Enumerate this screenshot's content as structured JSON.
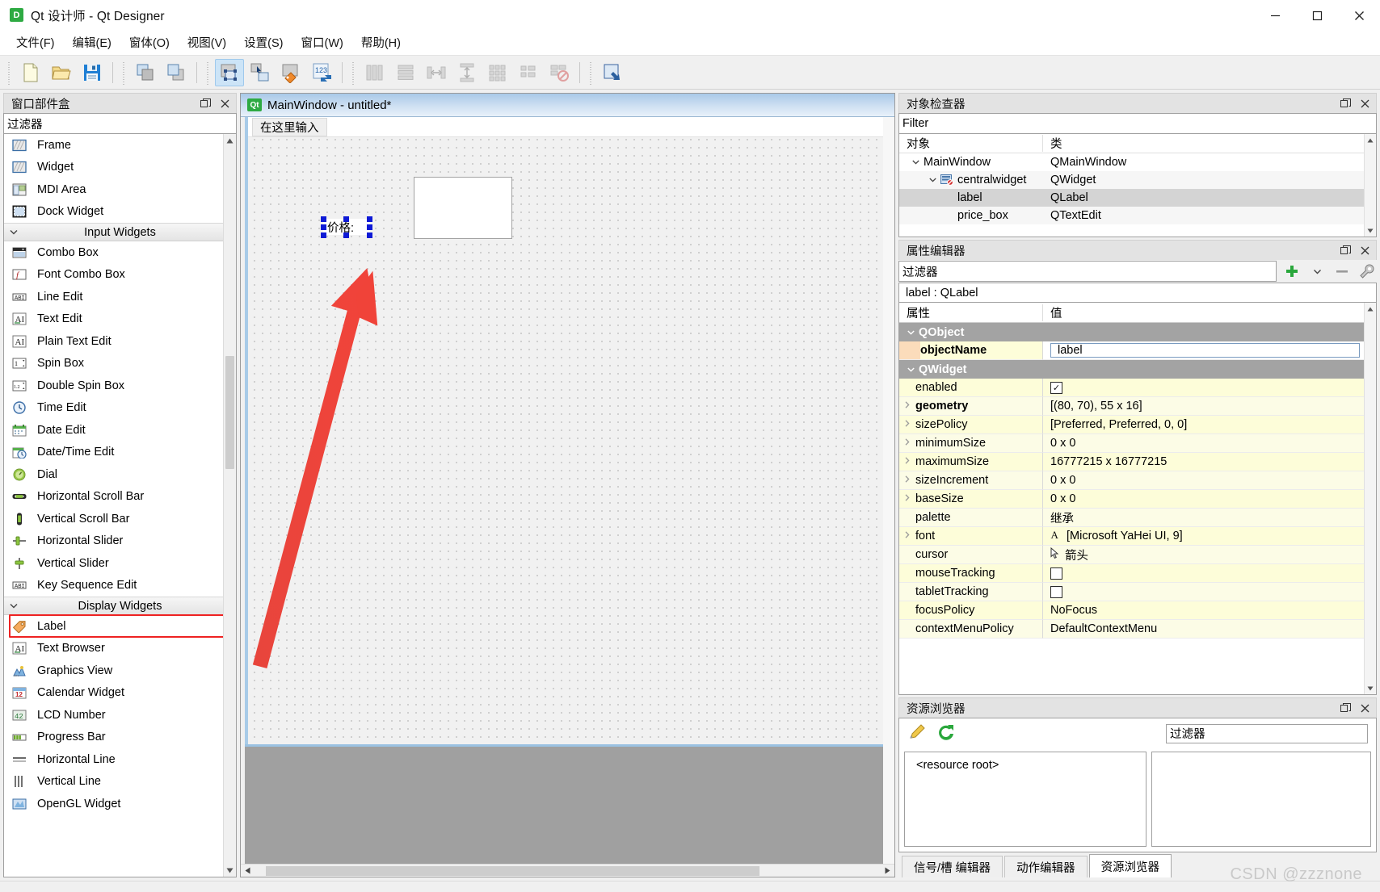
{
  "window": {
    "title": "Qt 设计师 - Qt Designer",
    "logo_text": "D",
    "minimize": "–",
    "maximize": "☐",
    "close": "✕"
  },
  "menubar": {
    "items": [
      {
        "label": "文件(F)"
      },
      {
        "label": "编辑(E)"
      },
      {
        "label": "窗体(O)"
      },
      {
        "label": "视图(V)"
      },
      {
        "label": "设置(S)"
      },
      {
        "label": "窗口(W)"
      },
      {
        "label": "帮助(H)"
      }
    ]
  },
  "toolbar": {
    "groups": [
      [
        "new-file-icon",
        "open-folder-icon",
        "save-disk-icon"
      ],
      [
        "copy-windows-icon",
        "paste-window-icon"
      ],
      [
        "edit-widgets-icon",
        "edit-signals-slots-icon",
        "edit-buddies-icon",
        "edit-tab-order-icon"
      ],
      [
        "layout-horizontally-icon",
        "layout-vertically-icon",
        "layout-splitter-h-icon",
        "layout-splitter-v-icon",
        "layout-grid-icon",
        "layout-form-icon",
        "break-layout-icon"
      ],
      [
        "adjust-size-icon"
      ]
    ],
    "active_index": "edit-widgets-icon"
  },
  "widget_box": {
    "title": "窗口部件盒",
    "filter_value": "过滤器",
    "float_icon": "undock-icon",
    "items": [
      {
        "label": "Frame",
        "icon": "frame-icon",
        "type": "item"
      },
      {
        "label": "Widget",
        "icon": "widget-icon",
        "type": "item"
      },
      {
        "label": "MDI Area",
        "icon": "mdi-area-icon",
        "type": "item"
      },
      {
        "label": "Dock Widget",
        "icon": "dock-widget-icon",
        "type": "item"
      },
      {
        "label": "Input Widgets",
        "type": "category"
      },
      {
        "label": "Combo Box",
        "icon": "combo-box-icon",
        "type": "item"
      },
      {
        "label": "Font Combo Box",
        "icon": "font-combo-box-icon",
        "type": "item"
      },
      {
        "label": "Line Edit",
        "icon": "line-edit-icon",
        "type": "item"
      },
      {
        "label": "Text Edit",
        "icon": "text-edit-icon",
        "type": "item"
      },
      {
        "label": "Plain Text Edit",
        "icon": "plain-text-edit-icon",
        "type": "item"
      },
      {
        "label": "Spin Box",
        "icon": "spin-box-icon",
        "type": "item"
      },
      {
        "label": "Double Spin Box",
        "icon": "double-spin-box-icon",
        "type": "item"
      },
      {
        "label": "Time Edit",
        "icon": "time-edit-icon",
        "type": "item"
      },
      {
        "label": "Date Edit",
        "icon": "date-edit-icon",
        "type": "item"
      },
      {
        "label": "Date/Time Edit",
        "icon": "date-time-edit-icon",
        "type": "item"
      },
      {
        "label": "Dial",
        "icon": "dial-icon",
        "type": "item"
      },
      {
        "label": "Horizontal Scroll Bar",
        "icon": "h-scrollbar-icon",
        "type": "item"
      },
      {
        "label": "Vertical Scroll Bar",
        "icon": "v-scrollbar-icon",
        "type": "item"
      },
      {
        "label": "Horizontal Slider",
        "icon": "h-slider-icon",
        "type": "item"
      },
      {
        "label": "Vertical Slider",
        "icon": "v-slider-icon",
        "type": "item"
      },
      {
        "label": "Key Sequence Edit",
        "icon": "key-sequence-edit-icon",
        "type": "item"
      },
      {
        "label": "Display Widgets",
        "type": "category"
      },
      {
        "label": "Label",
        "icon": "label-icon",
        "type": "item",
        "highlighted": true
      },
      {
        "label": "Text Browser",
        "icon": "text-browser-icon",
        "type": "item"
      },
      {
        "label": "Graphics View",
        "icon": "graphics-view-icon",
        "type": "item"
      },
      {
        "label": "Calendar Widget",
        "icon": "calendar-widget-icon",
        "type": "item"
      },
      {
        "label": "LCD Number",
        "icon": "lcd-number-icon",
        "type": "item"
      },
      {
        "label": "Progress Bar",
        "icon": "progress-bar-icon",
        "type": "item"
      },
      {
        "label": "Horizontal Line",
        "icon": "h-line-icon",
        "type": "item"
      },
      {
        "label": "Vertical Line",
        "icon": "v-line-icon",
        "type": "item"
      },
      {
        "label": "OpenGL Widget",
        "icon": "opengl-widget-icon",
        "type": "item"
      }
    ]
  },
  "form_editor": {
    "mdi_title": "MainWindow - untitled*",
    "qt_badge": "Qt",
    "menu_hint": "在这里输入",
    "label_text": "价格:",
    "annotation": "red-arrow-annotation"
  },
  "object_inspector": {
    "title": "对象检查器",
    "filter_placeholder": "Filter",
    "columns": [
      "对象",
      "类"
    ],
    "rows": [
      {
        "name": "MainWindow",
        "cls": "QMainWindow",
        "depth": 0,
        "expanded": true,
        "selected": false
      },
      {
        "name": "centralwidget",
        "cls": "QWidget",
        "depth": 1,
        "expanded": true,
        "selected": false,
        "icon": "central-widget-icon"
      },
      {
        "name": "label",
        "cls": "QLabel",
        "depth": 2,
        "selected": true
      },
      {
        "name": "price_box",
        "cls": "QTextEdit",
        "depth": 2,
        "selected": false
      }
    ]
  },
  "property_editor": {
    "title": "属性编辑器",
    "filter_value": "过滤器",
    "add_icon": "plus-green-icon",
    "remove_icon": "minus-icon",
    "config_icon": "wrench-icon",
    "target": "label : QLabel",
    "columns": [
      "属性",
      "值"
    ],
    "rows": [
      {
        "kind": "group",
        "name": "QObject"
      },
      {
        "kind": "prop",
        "name": "objectName",
        "value": "label",
        "bold": true,
        "editor": "text",
        "swatch": true
      },
      {
        "kind": "group",
        "name": "QWidget"
      },
      {
        "kind": "prop",
        "name": "enabled",
        "value": "",
        "editor": "checkbox-checked"
      },
      {
        "kind": "prop",
        "name": "geometry",
        "value": "[(80, 70), 55 x 16]",
        "bold": true,
        "expandable": true
      },
      {
        "kind": "prop",
        "name": "sizePolicy",
        "value": "[Preferred, Preferred, 0, 0]",
        "expandable": true
      },
      {
        "kind": "prop",
        "name": "minimumSize",
        "value": "0 x 0",
        "expandable": true
      },
      {
        "kind": "prop",
        "name": "maximumSize",
        "value": "16777215 x 16777215",
        "expandable": true
      },
      {
        "kind": "prop",
        "name": "sizeIncrement",
        "value": "0 x 0",
        "expandable": true
      },
      {
        "kind": "prop",
        "name": "baseSize",
        "value": "0 x 0",
        "expandable": true
      },
      {
        "kind": "prop",
        "name": "palette",
        "value": "继承"
      },
      {
        "kind": "prop",
        "name": "font",
        "value": "[Microsoft YaHei UI, 9]",
        "expandable": true,
        "icon": "font-A-icon"
      },
      {
        "kind": "prop",
        "name": "cursor",
        "value": "箭头",
        "icon": "cursor-arrow-icon"
      },
      {
        "kind": "prop",
        "name": "mouseTracking",
        "value": "",
        "editor": "checkbox"
      },
      {
        "kind": "prop",
        "name": "tabletTracking",
        "value": "",
        "editor": "checkbox"
      },
      {
        "kind": "prop",
        "name": "focusPolicy",
        "value": "NoFocus"
      },
      {
        "kind": "prop",
        "name": "contextMenuPolicy",
        "value": "DefaultContextMenu",
        "clipped": true
      }
    ]
  },
  "resource_browser": {
    "title": "资源浏览器",
    "edit_icon": "pencil-icon",
    "reload_icon": "refresh-green-icon",
    "filter_value": "过滤器",
    "root_label": "<resource root>",
    "tabs": [
      {
        "label": "信号/槽 编辑器",
        "active": false
      },
      {
        "label": "动作编辑器",
        "active": false
      },
      {
        "label": "资源浏览器",
        "active": true
      }
    ]
  },
  "watermark": "CSDN @zzznone"
}
